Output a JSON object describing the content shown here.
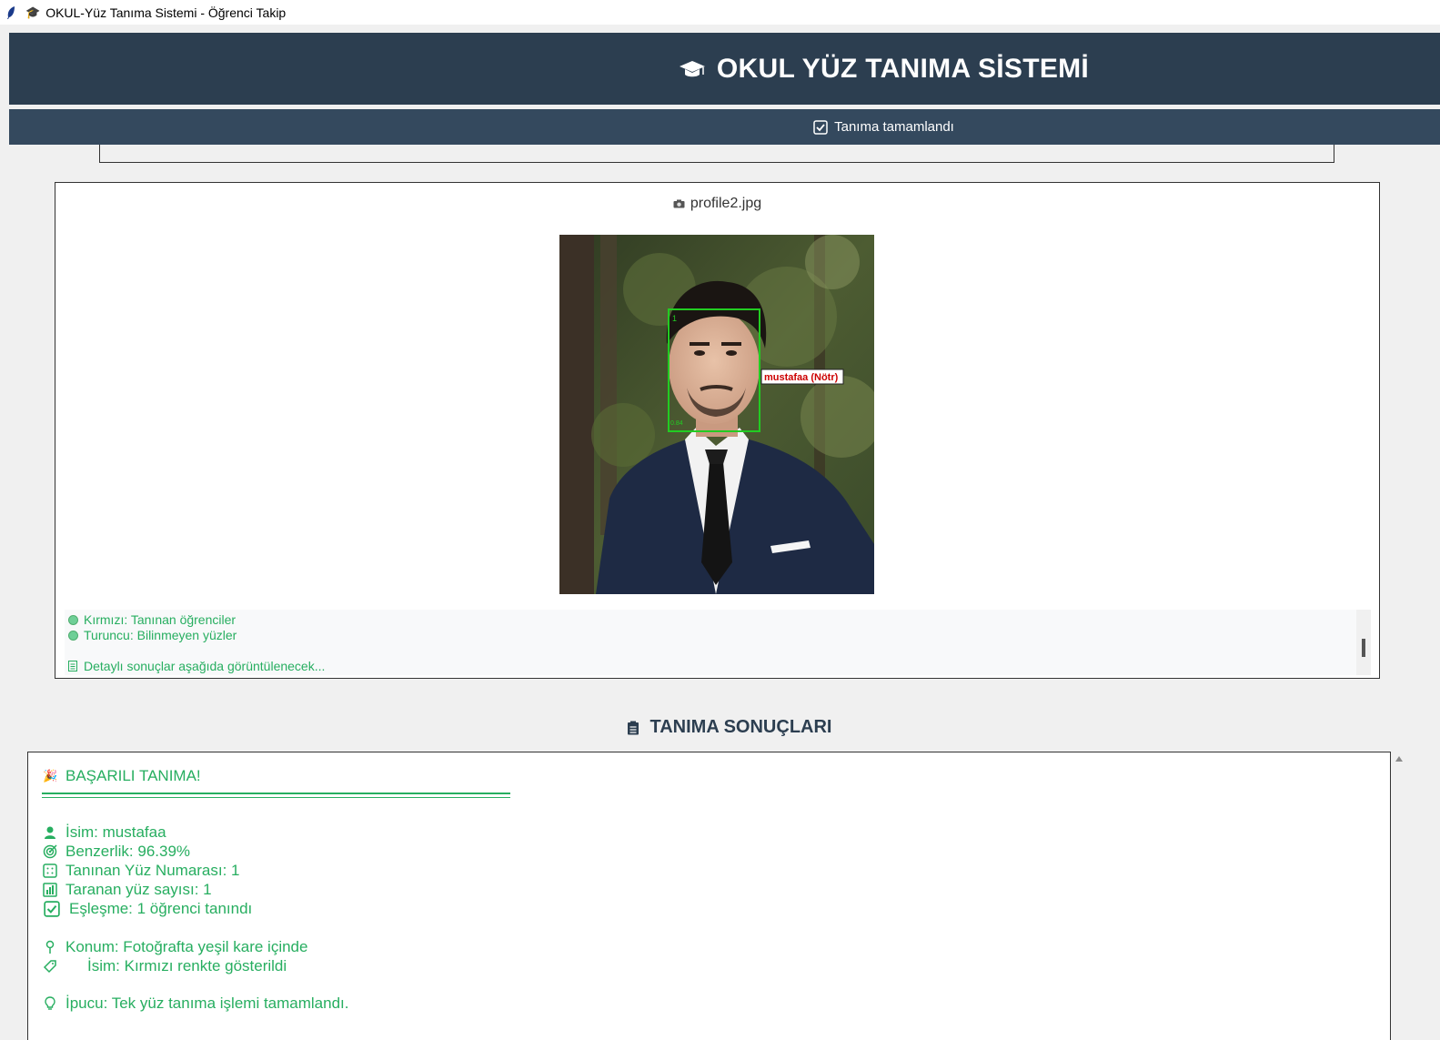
{
  "window": {
    "title": "OKUL-Yüz Tanıma Sistemi - Öğrenci Takip"
  },
  "header": {
    "title": "OKUL YÜZ TANIMA SİSTEMİ"
  },
  "status": {
    "text": "Tanıma tamamlandı"
  },
  "image_panel": {
    "filename": "profile2.jpg",
    "face_label": "mustafaa (Nötr)",
    "face_id": "1",
    "face_score": "0.84"
  },
  "legend": {
    "red": "Kırmızı: Tanınan öğrenciler",
    "orange": "Turuncu: Bilinmeyen yüzler",
    "details": "Detaylı sonuçlar aşağıda görüntülenecek..."
  },
  "results": {
    "section_title": "TANIMA SONUÇLARI",
    "heading": "BAŞARILI TANIMA!",
    "name": "İsim: mustafaa",
    "similarity": "Benzerlik: 96.39%",
    "face_number": "Tanınan Yüz Numarası: 1",
    "scanned": "Taranan yüz sayısı: 1",
    "match": "Eşleşme: 1 öğrenci tanındı",
    "location": "Konum: Fotoğrafta yeşil kare içinde",
    "name_color": "İsim: Kırmızı renkte gösterildi",
    "tip": "İpucu: Tek yüz tanıma işlemi tamamlandı."
  },
  "colors": {
    "header_bg": "#2c3e50",
    "status_bg": "#34495e",
    "result_text": "#27ae60",
    "face_box": "#22cc22",
    "face_label_text": "#cc0000"
  }
}
